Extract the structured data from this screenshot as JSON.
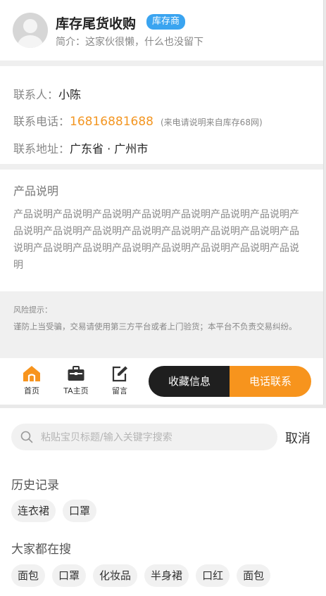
{
  "profile": {
    "shop_name": "库存尾货收购",
    "badge": "库存商",
    "intro": "简介：这家伙很懒，什么也没留下"
  },
  "contact": {
    "person_label": "联系人：",
    "person": "小陈",
    "phone_label": "联系电话：",
    "phone": "16816881688",
    "phone_note": "(来电请说明来自库存68网)",
    "address_label": "联系地址：",
    "address": "广东省 · 广州市"
  },
  "description": {
    "title": "产品说明",
    "body": "产品说明产品说明产品说明产品说明产品说明产品说明产品说明产品说明产品说明产品说明产品说明产品说明产品说明产品说明产品说明产品说明产品说明产品说明产品说明产品说明产品说明产品说明"
  },
  "risk": {
    "title": "风险提示：",
    "text": "谨防上当受骗，交易请使用第三方平台或者上门验货；本平台不负责交易纠纷。"
  },
  "actionbar": {
    "home": "首页",
    "ta_home": "TA主页",
    "message": "留言",
    "favorite": "收藏信息",
    "call": "电话联系",
    "accent": "#f7941d"
  },
  "search": {
    "placeholder": "粘贴宝贝标题/输入关键字搜索",
    "cancel": "取消",
    "history_title": "历史记录",
    "history": [
      "连衣裙",
      "口罩"
    ],
    "hot_title": "大家都在搜",
    "hot": [
      "面包",
      "口罩",
      "化妆品",
      "半身裙",
      "口红",
      "面包"
    ]
  }
}
